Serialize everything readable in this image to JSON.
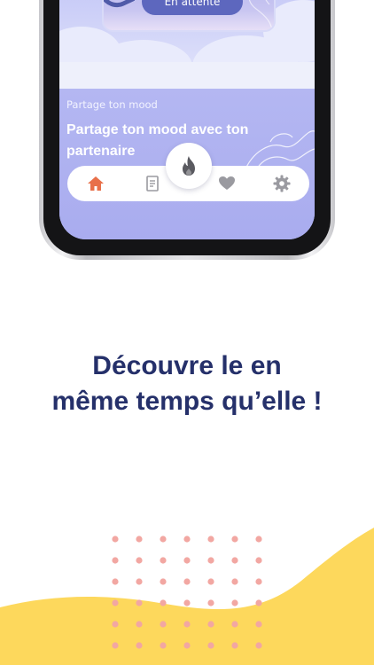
{
  "screen": {
    "status_button": "En attente",
    "mood_label": "Partage ton mood",
    "mood_title": "Partage ton mood avec ton partenaire"
  },
  "nav": {
    "items": [
      "home-icon",
      "journal-icon",
      "flame-icon",
      "heart-icon",
      "gear-icon"
    ],
    "active": "home-icon"
  },
  "headline": {
    "line1": "Découvre le en",
    "line2": "même temps qu’elle !"
  },
  "colors": {
    "headline": "#25306a",
    "accent_orange": "#e8704a",
    "lavender": "#b4b7f2",
    "button": "#5d67be",
    "yellow": "#fdd85c",
    "dots": "#f2a7a2"
  }
}
